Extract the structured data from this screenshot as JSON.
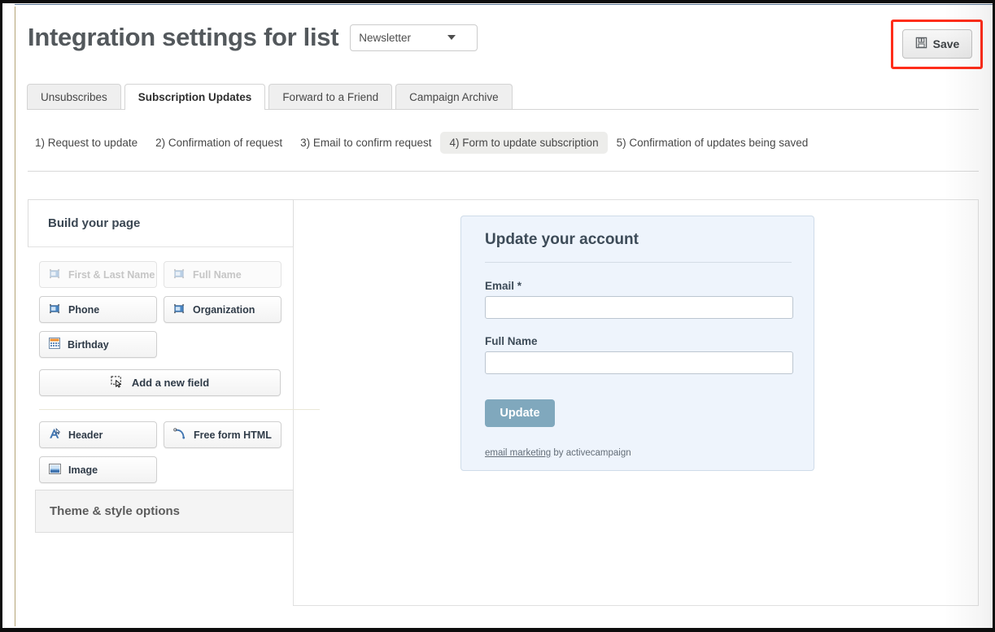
{
  "header": {
    "title": "Integration settings for list",
    "list_select": {
      "value": "Newsletter",
      "caret_icon": "chevron-down-icon"
    },
    "save": {
      "label": "Save",
      "icon": "floppy-disk-icon",
      "highlight_color": "#ff2d1a"
    }
  },
  "tabs": [
    {
      "label": "Unsubscribes",
      "active": false
    },
    {
      "label": "Subscription Updates",
      "active": true
    },
    {
      "label": "Forward to a Friend",
      "active": false
    },
    {
      "label": "Campaign Archive",
      "active": false
    }
  ],
  "steps": [
    {
      "label": "1) Request to update",
      "active": false
    },
    {
      "label": "2) Confirmation of request",
      "active": false
    },
    {
      "label": "3) Email to confirm request",
      "active": false
    },
    {
      "label": "4) Form to update subscription",
      "active": true
    },
    {
      "label": "5) Confirmation of updates being saved",
      "active": false
    }
  ],
  "builder": {
    "panel_title": "Build your page",
    "fields": [
      {
        "label": "First & Last Name",
        "icon": "text-field-icon",
        "disabled": true
      },
      {
        "label": "Full Name",
        "icon": "text-field-icon",
        "disabled": true
      },
      {
        "label": "Phone",
        "icon": "text-field-icon",
        "disabled": false
      },
      {
        "label": "Organization",
        "icon": "text-field-icon",
        "disabled": false
      },
      {
        "label": "Birthday",
        "icon": "calendar-icon",
        "disabled": false
      }
    ],
    "add_field": {
      "label": "Add a new field",
      "icon": "add-field-cursor-icon"
    },
    "blocks": [
      {
        "label": "Header",
        "icon": "header-text-icon"
      },
      {
        "label": "Free form HTML",
        "icon": "free-form-html-icon"
      },
      {
        "label": "Image",
        "icon": "image-icon"
      }
    ],
    "theme_panel": {
      "label": "Theme & style options"
    }
  },
  "preview": {
    "form": {
      "title": "Update your account",
      "accent_color": "#80a8bd",
      "background_color": "#eef4fc",
      "fields": [
        {
          "label": "Email *",
          "value": "",
          "placeholder": ""
        },
        {
          "label": "Full Name",
          "value": "",
          "placeholder": ""
        }
      ],
      "submit_label": "Update",
      "footer_link": "email marketing",
      "footer_text": " by activecampaign"
    }
  }
}
